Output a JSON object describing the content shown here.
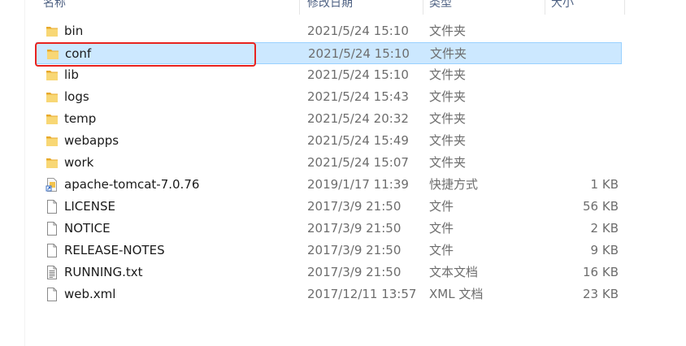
{
  "columns": {
    "name": "名称",
    "date": "修改日期",
    "type": "类型",
    "size": "大小"
  },
  "files": [
    {
      "name": "bin",
      "date": "2021/5/24 15:10",
      "type": "文件夹",
      "size": "",
      "icon": "folder-icon"
    },
    {
      "name": "conf",
      "date": "2021/5/24 15:10",
      "type": "文件夹",
      "size": "",
      "icon": "folder-icon",
      "selected": true
    },
    {
      "name": "lib",
      "date": "2021/5/24 15:10",
      "type": "文件夹",
      "size": "",
      "icon": "folder-icon"
    },
    {
      "name": "logs",
      "date": "2021/5/24 15:43",
      "type": "文件夹",
      "size": "",
      "icon": "folder-icon"
    },
    {
      "name": "temp",
      "date": "2021/5/24 20:32",
      "type": "文件夹",
      "size": "",
      "icon": "folder-icon"
    },
    {
      "name": "webapps",
      "date": "2021/5/24 15:49",
      "type": "文件夹",
      "size": "",
      "icon": "folder-icon"
    },
    {
      "name": "work",
      "date": "2021/5/24 15:07",
      "type": "文件夹",
      "size": "",
      "icon": "folder-icon"
    },
    {
      "name": "apache-tomcat-7.0.76",
      "date": "2019/1/17 11:39",
      "type": "快捷方式",
      "size": "1 KB",
      "icon": "shortcut-icon"
    },
    {
      "name": "LICENSE",
      "date": "2017/3/9 21:50",
      "type": "文件",
      "size": "56 KB",
      "icon": "file-icon"
    },
    {
      "name": "NOTICE",
      "date": "2017/3/9 21:50",
      "type": "文件",
      "size": "2 KB",
      "icon": "file-icon"
    },
    {
      "name": "RELEASE-NOTES",
      "date": "2017/3/9 21:50",
      "type": "文件",
      "size": "9 KB",
      "icon": "file-icon"
    },
    {
      "name": "RUNNING.txt",
      "date": "2017/3/9 21:50",
      "type": "文本文档",
      "size": "16 KB",
      "icon": "text-file-icon"
    },
    {
      "name": "web.xml",
      "date": "2017/12/11 13:57",
      "type": "XML 文档",
      "size": "23 KB",
      "icon": "file-icon"
    }
  ],
  "colors": {
    "selection_bg": "#cce8ff",
    "selection_border": "#99d1ff",
    "highlight": "#e8231f",
    "folder": "#f2c14e"
  }
}
